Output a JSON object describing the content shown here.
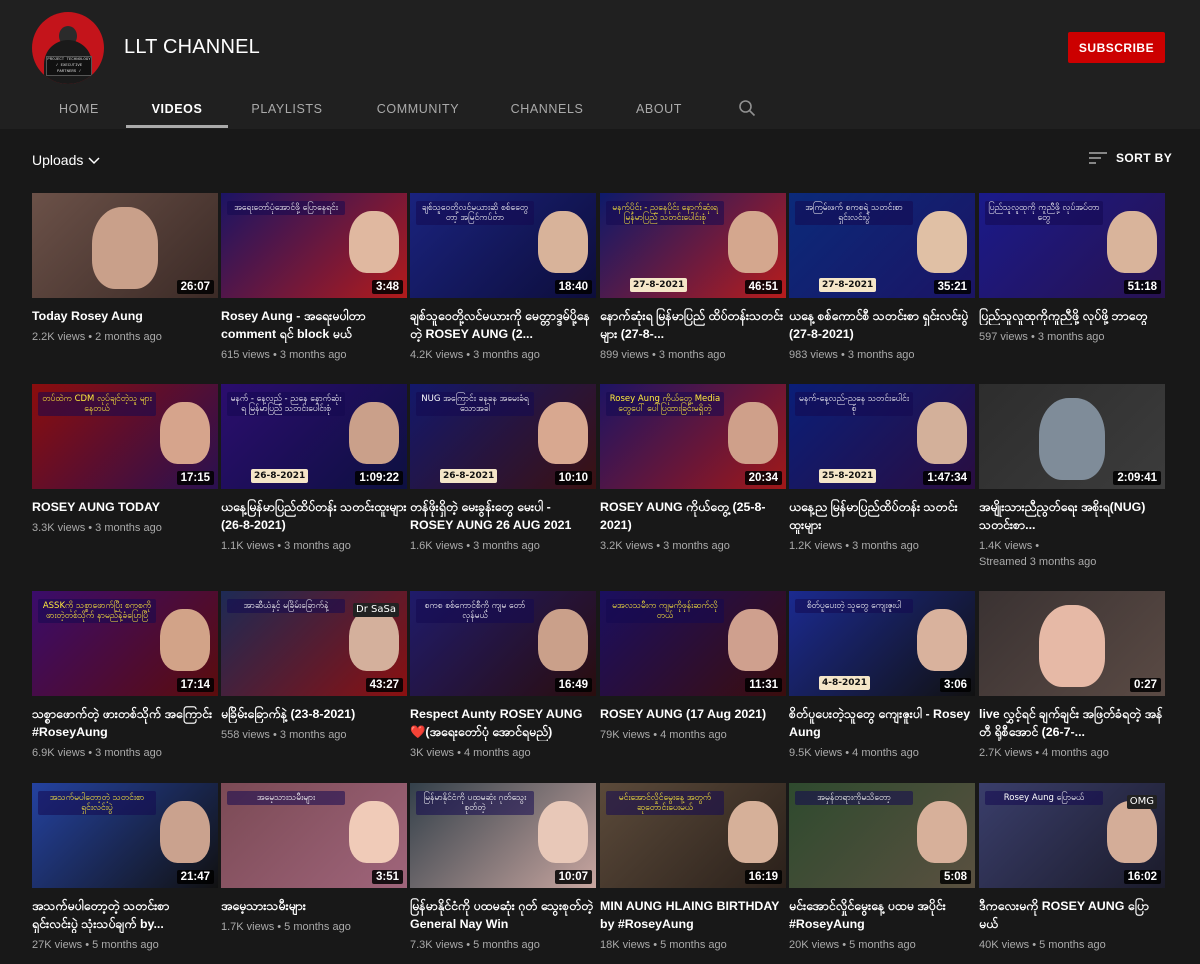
{
  "channel": {
    "name": "LLT CHANNEL",
    "avatar_caption": "PROJECT TECHNOLOGY / EXECUTIVE PARTNERS / GOVERNMENT",
    "subscribe_label": "SUBSCRIBE"
  },
  "tabs": [
    "HOME",
    "VIDEOS",
    "PLAYLISTS",
    "COMMUNITY",
    "CHANNELS",
    "ABOUT"
  ],
  "active_tab": "VIDEOS",
  "toolbar": {
    "uploads_label": "Uploads",
    "sort_label": "SORT BY"
  },
  "colors": {
    "accent": "#cc0000",
    "background": "#181818",
    "header": "#202020"
  },
  "videos": [
    {
      "title": "Today Rosey Aung",
      "views": "2.2K views",
      "age": "2 months ago",
      "duration": "26:07",
      "overlay": ""
    },
    {
      "title": "Rosey Aung - အရေးမပါတာ comment ရင် block မယ်",
      "views": "615 views",
      "age": "3 months ago",
      "duration": "3:48",
      "overlay": "အရေးတော်ပုံအောင်ဖို့ ပြောနေရင်း"
    },
    {
      "title": "ချစ်သူဝေတို့လင်မယားကို မေတ္တာဒ္ဒမ်ပို့နေတဲ့ ROSEY AUNG (2...",
      "views": "4.2K views",
      "age": "3 months ago",
      "duration": "18:40",
      "overlay": "ချစ်သူဝေတို့လင်မယားဆို စစ်တွေေတာ့ အမြင်ကပ်တာ"
    },
    {
      "title": "နောက်ဆုံးရ မြန်မာပြည် ထိပ်တန်းသတင်းများ (27-8-...",
      "views": "899 views",
      "age": "3 months ago",
      "duration": "46:51",
      "overlay": "မနက်ပိုင်း - ညနေပိုင်း နောက်ဆုံးရ မြန်မာပြည် သတင်းပေါင်းစုံ",
      "date": "27-8-2021"
    },
    {
      "title": "ယနေ့ စစ်ကောင်စီ သတင်းစာ ရှင်းလင်းပွဲ (27-8-2021)",
      "views": "983 views",
      "age": "3 months ago",
      "duration": "35:21",
      "overlay": "အကြမ်းဖက် စကစရဲ့ သတင်းစာရှင်းလင်းပွဲ",
      "date": "27-8-2021"
    },
    {
      "title": "ပြည်သူလူထုကိုကူညီဖို့ လုပ်ဖို့ ဘာတွေ",
      "views": "597 views",
      "age": "3 months ago",
      "duration": "51:18",
      "overlay": "ပြည်သူလူထုကို ကူညီဖို့ လုပ်အပ်တာတွေ"
    },
    {
      "title": "ROSEY AUNG TODAY",
      "views": "3.3K views",
      "age": "3 months ago",
      "duration": "17:15",
      "overlay": "တပ်ထဲက CDM လုပ်ချင်တဲ့သူ များနေတယ်"
    },
    {
      "title": "ယနေ့မြန်မာပြည်ထိပ်တန်း သတင်းထူးများ (26-8-2021)",
      "views": "1.1K views",
      "age": "3 months ago",
      "duration": "1:09:22",
      "overlay": "မနက် - နေ့လည် - ညနေ နောက်ဆုံးရ မြန်မာပြည် သတင်းပေါင်းစုံ",
      "date": "26-8-2021"
    },
    {
      "title": "တန်ဖိုးရှိတဲ့ မေးခွန်းတွေ မေးပါ - ROSEY AUNG 26 AUG 2021",
      "views": "1.6K views",
      "age": "3 months ago",
      "duration": "10:10",
      "overlay": "NUG အကြောင်း ခနခန အမေးခံရသောအခါ",
      "date": "26-8-2021"
    },
    {
      "title": "ROSEY AUNG ကိုယ်တွေ့ (25-8-2021)",
      "views": "3.2K views",
      "age": "3 months ago",
      "duration": "20:34",
      "overlay": "Rosey Aung ကိုယ်တွေ့ Media တွေပေါ် ပေါ်ပြထားခြင်းမရှိတဲ့"
    },
    {
      "title": "ယနေ့ည မြန်မာပြည်ထိပ်တန်း သတင်း ထူးများ",
      "views": "1.2K views",
      "age": "3 months ago",
      "duration": "1:47:34",
      "overlay": "မနက်-နေ့လည်-ညနေ သတင်းပေါင်းစုံ",
      "date": "25-8-2021"
    },
    {
      "title": "အမျိုးသားညီညွတ်ရေး အစိုးရ(NUG) သတင်းစာ...",
      "views": "1.4K views",
      "age": "Streamed 3 months ago",
      "duration": "2:09:41",
      "overlay": ""
    },
    {
      "title": "သစ္စာဖောက်တဲ့ ဖားတစ်သိုက် အကြောင်း #RoseyAung",
      "views": "6.9K views",
      "age": "3 months ago",
      "duration": "17:14",
      "overlay": "ASSKကို သစ္စာဖောက်ပြီး စကစကို ဖားတဲ့တစ်သိုက် နာမည်နဲ့ခံပြောပြီ"
    },
    {
      "title": "မခြိမ်းခြောက်နဲ့ (23-8-2021)",
      "views": "558 views",
      "age": "3 months ago",
      "duration": "43:27",
      "overlay": "အာဆီယံနှင့် မခြိမ်းခြောက်နဲ့",
      "caption": "Dr SaSa"
    },
    {
      "title": "Respect Aunty ROSEY AUNG ❤️(အရေးတော်ပုံ အောင်ရမည်)",
      "views": "3K views",
      "age": "4 months ago",
      "duration": "16:49",
      "overlay": "စကစ စစ်ကောင်စီကို ကျမ တော်လှန်မယ်"
    },
    {
      "title": "ROSEY AUNG (17 Aug 2021)",
      "views": "79K views",
      "age": "4 months ago",
      "duration": "11:31",
      "overlay": "မအလသမီးက ကျမကိုဖုန်းဆက်လိုတယ်"
    },
    {
      "title": "စိတ်ပူပေးတဲ့သူတွေ ကျေးဇူးပါ - Rosey Aung",
      "views": "9.5K views",
      "age": "4 months ago",
      "duration": "3:06",
      "overlay": "စိတ်ပူပေးတဲ့ သူတွေ ကျေးဇူးပါ",
      "date": "4-8-2021"
    },
    {
      "title": "live လွှင့်ရင် ချက်ချင်း အဖြတ်ခံရတဲ့ အန်တီ ရိုစီအောင် (26-7-...",
      "views": "2.7K views",
      "age": "4 months ago",
      "duration": "0:27",
      "overlay": ""
    },
    {
      "title": "အသက်မပါတော့တဲ့ သတင်းစာ ရှင်းလင်းပွဲ သုံးသပ်ချက် by...",
      "views": "27K views",
      "age": "5 months ago",
      "duration": "21:47",
      "overlay": "အသက်မပါတော့တဲ့ သတင်းစာရှင်းလင်းပွဲ"
    },
    {
      "title": "အမေ့သားသမီးများ",
      "views": "1.7K views",
      "age": "5 months ago",
      "duration": "3:51",
      "overlay": "အမေ့သားသမီးများ"
    },
    {
      "title": "မြန်မာနိုင်ငံကို ပထမဆုံး ဂုတ် သွေးစုတ်တဲ့ General Nay Win",
      "views": "7.3K views",
      "age": "5 months ago",
      "duration": "10:07",
      "overlay": "မြန်မာနိုင်ငံကို ပထမဆုံး ဂုတ်သွေးစုတ်တဲ့"
    },
    {
      "title": "MIN AUNG HLAING BIRTHDAY by #RoseyAung",
      "views": "18K views",
      "age": "5 months ago",
      "duration": "16:19",
      "overlay": "မင်းအောင်လှိုင်မွေးနေ့ အတွက်ဆုတောင်းပေးမယ်"
    },
    {
      "title": "မင်းအောင်လှိုင်မွေးနေ့ ပထမ အပိုင်း #RoseyAung",
      "views": "20K views",
      "age": "5 months ago",
      "duration": "5:08",
      "overlay": "အမှန်တရားကိုမသိတော့"
    },
    {
      "title": "ဒီကလေးမကို ROSEY AUNG ပြောမယ်",
      "views": "40K views",
      "age": "5 months ago",
      "duration": "16:02",
      "overlay": "Rosey Aung ပြောမယ်",
      "caption": "OMG"
    }
  ]
}
